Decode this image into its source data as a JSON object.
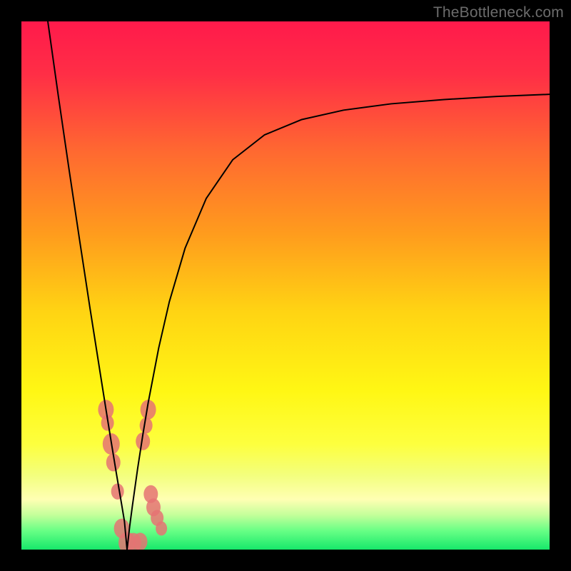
{
  "watermark": "TheBottleneck.com",
  "chart_data": {
    "type": "line",
    "title": "",
    "xlabel": "",
    "ylabel": "",
    "xlim": [
      0,
      100
    ],
    "ylim": [
      0,
      100
    ],
    "grid": false,
    "legend": false,
    "background_gradient": {
      "stops": [
        {
          "offset": 0.0,
          "color": "#ff1a4b"
        },
        {
          "offset": 0.1,
          "color": "#ff2e46"
        },
        {
          "offset": 0.25,
          "color": "#ff6a30"
        },
        {
          "offset": 0.4,
          "color": "#ff9b1d"
        },
        {
          "offset": 0.55,
          "color": "#ffd413"
        },
        {
          "offset": 0.7,
          "color": "#fff714"
        },
        {
          "offset": 0.8,
          "color": "#fdff3e"
        },
        {
          "offset": 0.86,
          "color": "#f3ff7e"
        },
        {
          "offset": 0.905,
          "color": "#ffffb3"
        },
        {
          "offset": 0.935,
          "color": "#c3ff9a"
        },
        {
          "offset": 0.965,
          "color": "#66ff85"
        },
        {
          "offset": 1.0,
          "color": "#17e86b"
        }
      ]
    },
    "series": [
      {
        "name": "bottleneck-curve",
        "color": "#000000",
        "stroke_width": 2,
        "notch_x": 20,
        "x": [
          5,
          7,
          9,
          11,
          13,
          15,
          16,
          17,
          18,
          19,
          19.5,
          20,
          20.5,
          21,
          22,
          23,
          24,
          26,
          28,
          31,
          35,
          40,
          46,
          53,
          61,
          70,
          80,
          90,
          100
        ],
        "y": [
          100,
          85.8,
          72.1,
          58.7,
          45.6,
          32.9,
          26.6,
          20.4,
          14.3,
          8.4,
          5.4,
          0,
          4.4,
          8.2,
          15.3,
          21.8,
          27.8,
          38.2,
          46.9,
          57.1,
          66.5,
          73.8,
          78.5,
          81.4,
          83.2,
          84.4,
          85.2,
          85.8,
          86.2
        ]
      }
    ],
    "scatter": {
      "name": "sample-points",
      "color": "#e57373",
      "opacity": 0.85,
      "points": [
        {
          "x": 16.0,
          "y": 26.5,
          "r": 11
        },
        {
          "x": 16.3,
          "y": 24.0,
          "r": 9
        },
        {
          "x": 17.0,
          "y": 20.0,
          "r": 12
        },
        {
          "x": 17.4,
          "y": 16.5,
          "r": 10
        },
        {
          "x": 18.2,
          "y": 11.0,
          "r": 9
        },
        {
          "x": 19.0,
          "y": 4.0,
          "r": 11
        },
        {
          "x": 20.0,
          "y": 1.3,
          "r": 12
        },
        {
          "x": 21.2,
          "y": 1.3,
          "r": 11
        },
        {
          "x": 22.5,
          "y": 1.5,
          "r": 10
        },
        {
          "x": 24.0,
          "y": 26.5,
          "r": 11
        },
        {
          "x": 23.6,
          "y": 23.5,
          "r": 9
        },
        {
          "x": 23.0,
          "y": 20.5,
          "r": 10
        },
        {
          "x": 24.5,
          "y": 10.5,
          "r": 10
        },
        {
          "x": 25.0,
          "y": 8.0,
          "r": 10
        },
        {
          "x": 25.7,
          "y": 6.0,
          "r": 9
        },
        {
          "x": 26.5,
          "y": 4.0,
          "r": 8
        }
      ]
    }
  }
}
